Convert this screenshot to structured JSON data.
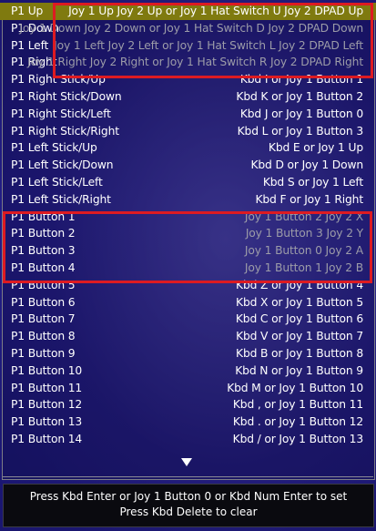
{
  "rows": [
    {
      "name": "P1 Up",
      "value": "Joy 1 Up Joy 2 Up or Joy 1 Hat Switch U Joy 2 DPAD Up",
      "selected": true,
      "dim": false
    },
    {
      "name": "P1 Down",
      "value": "Joy 1 Down Joy 2 Down or Joy 1 Hat Switch D Joy 2 DPAD Down",
      "selected": false,
      "dim": true
    },
    {
      "name": "P1 Left",
      "value": "Joy 1 Left Joy 2 Left or Joy 1 Hat Switch L Joy 2 DPAD Left",
      "selected": false,
      "dim": true
    },
    {
      "name": "P1 Right",
      "value": "Joy 1 Right Joy 2 Right or Joy 1 Hat Switch R Joy 2 DPAD Right",
      "selected": false,
      "dim": true
    },
    {
      "name": "P1 Right Stick/Up",
      "value": "Kbd I or Joy 1 Button 1",
      "selected": false,
      "dim": false
    },
    {
      "name": "P1 Right Stick/Down",
      "value": "Kbd K or Joy 1 Button 2",
      "selected": false,
      "dim": false
    },
    {
      "name": "P1 Right Stick/Left",
      "value": "Kbd J or Joy 1 Button 0",
      "selected": false,
      "dim": false
    },
    {
      "name": "P1 Right Stick/Right",
      "value": "Kbd L or Joy 1 Button 3",
      "selected": false,
      "dim": false
    },
    {
      "name": "P1 Left Stick/Up",
      "value": "Kbd E or Joy 1 Up",
      "selected": false,
      "dim": false
    },
    {
      "name": "P1 Left Stick/Down",
      "value": "Kbd D or Joy 1 Down",
      "selected": false,
      "dim": false
    },
    {
      "name": "P1 Left Stick/Left",
      "value": "Kbd S or Joy 1 Left",
      "selected": false,
      "dim": false
    },
    {
      "name": "P1 Left Stick/Right",
      "value": "Kbd F or Joy 1 Right",
      "selected": false,
      "dim": false
    },
    {
      "name": "P1 Button 1",
      "value": "Joy 1 Button 2 Joy 2 X",
      "selected": false,
      "dim": true
    },
    {
      "name": "P1 Button 2",
      "value": "Joy 1 Button 3 Joy 2 Y",
      "selected": false,
      "dim": true
    },
    {
      "name": "P1 Button 3",
      "value": "Joy 1 Button 0 Joy 2 A",
      "selected": false,
      "dim": true
    },
    {
      "name": "P1 Button 4",
      "value": "Joy 1 Button 1 Joy 2 B",
      "selected": false,
      "dim": true
    },
    {
      "name": "P1 Button 5",
      "value": "Kbd Z or Joy 1 Button 4",
      "selected": false,
      "dim": false
    },
    {
      "name": "P1 Button 6",
      "value": "Kbd X or Joy 1 Button 5",
      "selected": false,
      "dim": false
    },
    {
      "name": "P1 Button 7",
      "value": "Kbd C or Joy 1 Button 6",
      "selected": false,
      "dim": false
    },
    {
      "name": "P1 Button 8",
      "value": "Kbd V or Joy 1 Button 7",
      "selected": false,
      "dim": false
    },
    {
      "name": "P1 Button 9",
      "value": "Kbd B or Joy 1 Button 8",
      "selected": false,
      "dim": false
    },
    {
      "name": "P1 Button 10",
      "value": "Kbd N or Joy 1 Button 9",
      "selected": false,
      "dim": false
    },
    {
      "name": "P1 Button 11",
      "value": "Kbd M or Joy 1 Button 10",
      "selected": false,
      "dim": false
    },
    {
      "name": "P1 Button 12",
      "value": "Kbd , or Joy 1 Button 11",
      "selected": false,
      "dim": false
    },
    {
      "name": "P1 Button 13",
      "value": "Kbd . or Joy 1 Button 12",
      "selected": false,
      "dim": false
    },
    {
      "name": "P1 Button 14",
      "value": "Kbd / or Joy 1 Button 13",
      "selected": false,
      "dim": false
    }
  ],
  "scroll_indicator_icon": "down-arrow-icon",
  "footer": {
    "line1": "Press Kbd Enter or Joy 1 Button 0 or Kbd Num Enter to set",
    "line2": "Press Kbd Delete to clear"
  },
  "colors": {
    "selected_row": "#7f7a0f",
    "dim_text": "#9c9ca8",
    "highlight_box": "#dd1b22"
  }
}
